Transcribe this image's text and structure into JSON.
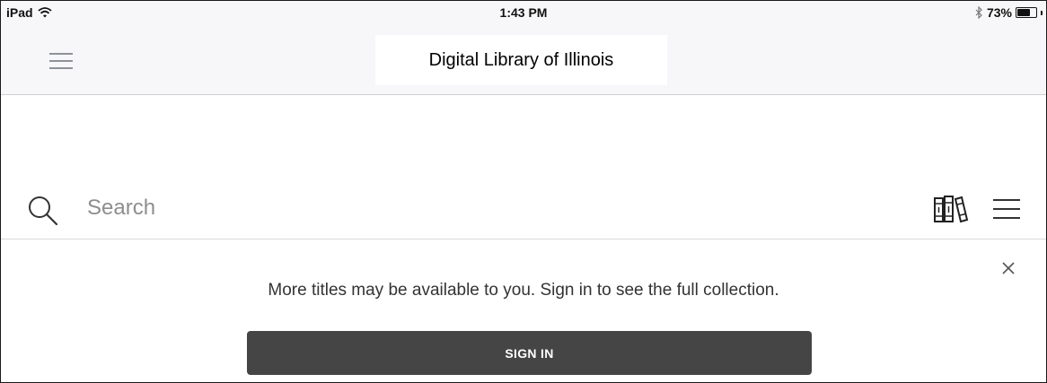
{
  "status_bar": {
    "device": "iPad",
    "time": "1:43 PM",
    "battery": "73%",
    "battery_level": 0.73,
    "icons": [
      "wifi-icon",
      "bluetooth-icon",
      "battery-icon"
    ]
  },
  "header": {
    "title": "Digital Library of Illinois",
    "menu_icon": "hamburger-menu-icon"
  },
  "search": {
    "placeholder": "Search",
    "value": "",
    "icons": [
      "search-icon",
      "library-books-icon",
      "hamburger-menu-icon"
    ]
  },
  "banner": {
    "message": "More titles may be available to you. Sign in to see the full collection.",
    "button_label": "SIGN IN",
    "close_icon": "close-icon"
  },
  "colors": {
    "header_bg": "#f7f7f9",
    "button_bg": "#454545",
    "button_text": "#ffffff",
    "divider": "#d9d9d9"
  }
}
